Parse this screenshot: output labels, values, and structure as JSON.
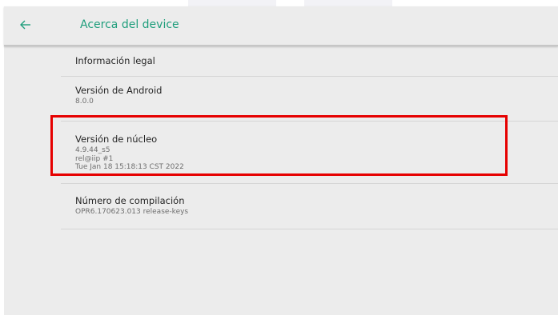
{
  "appbar": {
    "title": "Acerca del device",
    "back_icon": "arrow-left-icon",
    "accent_color": "#1f9e7c"
  },
  "items": [
    {
      "title": "Información legal"
    },
    {
      "title": "Versión de Android",
      "lines": [
        "8.0.0"
      ]
    },
    {
      "title": "Versión de núcleo",
      "lines": [
        "4.9.44_s5",
        "rel@iip #1",
        "Tue Jan 18 15:18:13 CST 2022"
      ]
    },
    {
      "title": "Número de compilación",
      "lines": [
        "OPR6.170623.013 release-keys"
      ]
    }
  ],
  "highlight": {
    "color": "#e60000"
  }
}
